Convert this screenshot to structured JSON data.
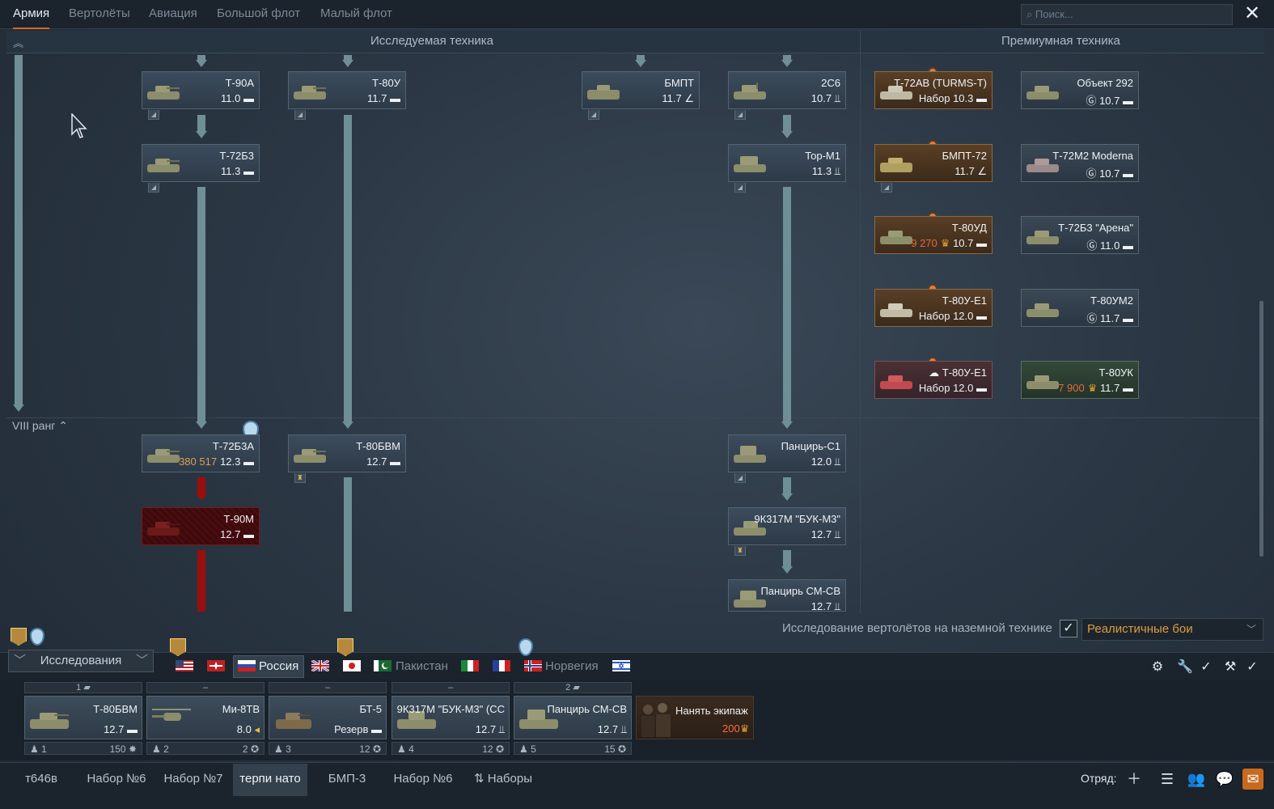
{
  "top_tabs": [
    "Армия",
    "Вертолёты",
    "Авиация",
    "Большой флот",
    "Малый флот"
  ],
  "search_placeholder": "Поиск...",
  "headers": {
    "research": "Исследуемая техника",
    "premium": "Премиумная техника"
  },
  "rank_label": "VIII ранг",
  "tree": [
    {
      "id": "t90a",
      "name": "Т-90А",
      "br": "11.0"
    },
    {
      "id": "t80u",
      "name": "Т-80У",
      "br": "11.7"
    },
    {
      "id": "bmpt",
      "name": "БМПТ",
      "br": "11.7"
    },
    {
      "id": "2s6",
      "name": "2С6",
      "br": "10.7"
    },
    {
      "id": "t72b3",
      "name": "Т-72Б3",
      "br": "11.3"
    },
    {
      "id": "torm1",
      "name": "Тор-М1",
      "br": "11.3"
    },
    {
      "id": "t72b3a",
      "name": "Т-72Б3А",
      "br": "12.3",
      "rp": "380 517"
    },
    {
      "id": "t80bvm",
      "name": "Т-80БВМ",
      "br": "12.7"
    },
    {
      "id": "pantsir",
      "name": "Панцирь-С1",
      "br": "12.0"
    },
    {
      "id": "t90m",
      "name": "Т-90М",
      "br": "12.7"
    },
    {
      "id": "buk",
      "name": "9К317М \"БУК-М3\"",
      "br": "12.7"
    },
    {
      "id": "pantsirsm",
      "name": "Панцирь СМ-СВ",
      "br": "12.7"
    }
  ],
  "premium": [
    {
      "name": "Т-72АВ (TURMS-T)",
      "price": "Набор",
      "br": "10.3"
    },
    {
      "name": "Объект 292",
      "price": "",
      "br": "10.7"
    },
    {
      "name": "БМПТ-72",
      "price": "",
      "br": "11.7"
    },
    {
      "name": "Т-72М2 Moderna",
      "price": "",
      "br": "10.7"
    },
    {
      "name": "Т-80УД",
      "price": "9 270",
      "br": "10.7"
    },
    {
      "name": "Т-72Б3 \"Арена\"",
      "price": "",
      "br": "11.0"
    },
    {
      "name": "Т-80У-Е1",
      "price": "Набор",
      "br": "12.0"
    },
    {
      "name": "Т-80УМ2",
      "price": "",
      "br": "11.7"
    },
    {
      "name": "Т-80У-Е1",
      "price": "Набор",
      "br": "12.0"
    },
    {
      "name": "Т-80УК",
      "price": "7 900",
      "br": "11.7"
    }
  ],
  "heli_research_label": "Исследование вертолётов на наземной технике",
  "game_mode": "Реалистичные бои",
  "research_button": "Исследования",
  "nations": {
    "russia": "Россия",
    "pakistan": "Пакистан",
    "norway": "Норвегия"
  },
  "crew_slots": [
    {
      "top": "1",
      "name": "Т-80БВМ",
      "br": "12.7",
      "crew": "1",
      "count": "150"
    },
    {
      "top": "–",
      "name": "Ми-8ТВ",
      "br": "8.0",
      "crew": "2",
      "count": "2"
    },
    {
      "top": "–",
      "name": "БТ-5",
      "br": "Резерв",
      "crew": "3",
      "count": "12"
    },
    {
      "top": "–",
      "name": "9К317М \"БУК-М3\" (СС",
      "br": "12.7",
      "crew": "4",
      "count": "12"
    },
    {
      "top": "2",
      "name": "Панцирь СМ-СВ",
      "br": "12.7",
      "crew": "5",
      "count": "15"
    }
  ],
  "hire_crew": {
    "label": "Нанять экипаж",
    "price": "200"
  },
  "presets": [
    "т646в",
    "Набор №6",
    "Набор №7",
    "терпи нато",
    "БМП-3",
    "Набор №6",
    "Наборы"
  ],
  "squad_label": "Отряд:",
  "colors": {
    "accent": "#d7642c",
    "mode_text": "#e09b3c",
    "researched_line": "#6f8f97",
    "in_research_line": "#9a0e0e",
    "price_red": "#ff6a3a"
  }
}
